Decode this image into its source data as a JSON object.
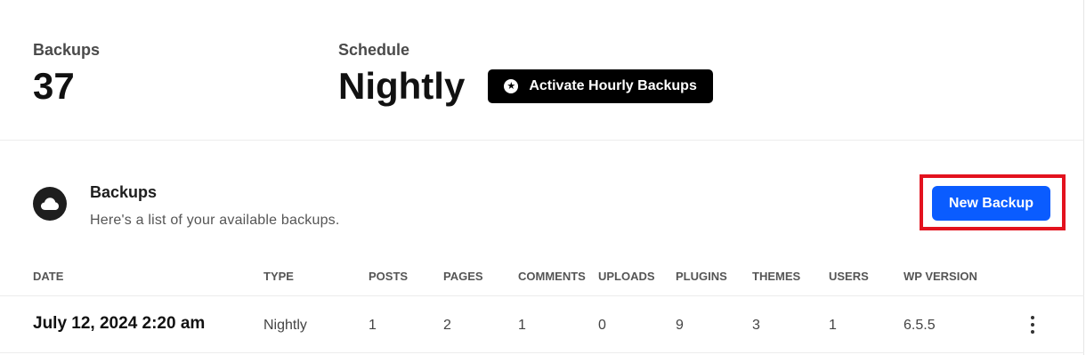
{
  "stats": {
    "backups_label": "Backups",
    "backups_value": "37",
    "schedule_label": "Schedule",
    "schedule_value": "Nightly",
    "hourly_button_label": "Activate Hourly Backups"
  },
  "section": {
    "title": "Backups",
    "description": "Here's a list of your available backups.",
    "icon": "cloud-icon",
    "new_backup_label": "New Backup",
    "highlight_color": "#e3121e",
    "button_color": "#0a5cff"
  },
  "table": {
    "headers": [
      "DATE",
      "TYPE",
      "POSTS",
      "PAGES",
      "COMMENTS",
      "UPLOADS",
      "PLUGINS",
      "THEMES",
      "USERS",
      "WP VERSION"
    ],
    "rows": [
      {
        "date": "July 12, 2024 2:20 am",
        "type": "Nightly",
        "posts": "1",
        "pages": "2",
        "comments": "1",
        "uploads": "0",
        "plugins": "9",
        "themes": "3",
        "users": "1",
        "wp_version": "6.5.5"
      }
    ]
  }
}
